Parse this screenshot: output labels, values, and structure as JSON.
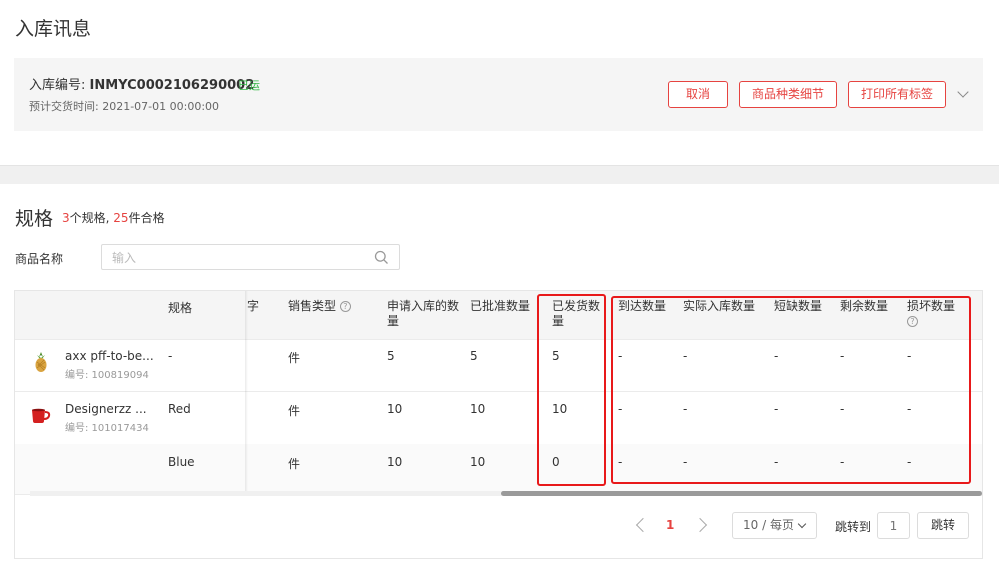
{
  "page": {
    "title": "入库讯息"
  },
  "order": {
    "number_label": "入库编号: ",
    "number": "INMYC0002106290002",
    "status": "已运",
    "eta": "预计交货时间: 2021-07-01 00:00:00",
    "status_color": "#34b846"
  },
  "actions": {
    "cancel": "取消",
    "details": "商品种类细节",
    "print": "打印所有标签"
  },
  "specs": {
    "title": "规格",
    "spec_count": "3",
    "spec_count_suffix": "个规格, ",
    "qualified_count": "25",
    "qualified_suffix": "件合格"
  },
  "filter": {
    "label": "商品名称",
    "placeholder": "输入"
  },
  "table": {
    "headers": {
      "spec": "规格",
      "partial": "字",
      "sale_type": "销售类型",
      "requested_l1": "申请入库的数",
      "requested_l2": "量",
      "approved": "已批准数量",
      "shipped_l1": "已发货数",
      "shipped_l2": "量",
      "arrived": "到达数量",
      "actual": "实际入库数量",
      "short": "短缺数量",
      "remaining": "剩余数量",
      "damaged": "损坏数量"
    },
    "rows": [
      {
        "product": "axx pff-to-be...",
        "sku": "编号: 100819094",
        "spec": "-",
        "sale_type": "件",
        "requested": "5",
        "approved": "5",
        "shipped": "5",
        "arrived": "-",
        "actual": "-",
        "short": "-",
        "remaining": "-",
        "damaged": "-"
      },
      {
        "product": "Designerzz ...",
        "sku": "编号: 101017434",
        "spec": "Red",
        "sale_type": "件",
        "requested": "10",
        "approved": "10",
        "shipped": "10",
        "arrived": "-",
        "actual": "-",
        "short": "-",
        "remaining": "-",
        "damaged": "-"
      },
      {
        "product": "",
        "sku": "",
        "spec": "Blue",
        "sale_type": "件",
        "requested": "10",
        "approved": "10",
        "shipped": "0",
        "arrived": "-",
        "actual": "-",
        "short": "-",
        "remaining": "-",
        "damaged": "-"
      }
    ]
  },
  "pagination": {
    "current": "1",
    "page_size": "10 / 每页",
    "jump_label": "跳转到",
    "jump_value": "1",
    "jump_button": "跳转"
  },
  "colors": {
    "accent": "#e64340",
    "highlight": "#e8191a"
  }
}
